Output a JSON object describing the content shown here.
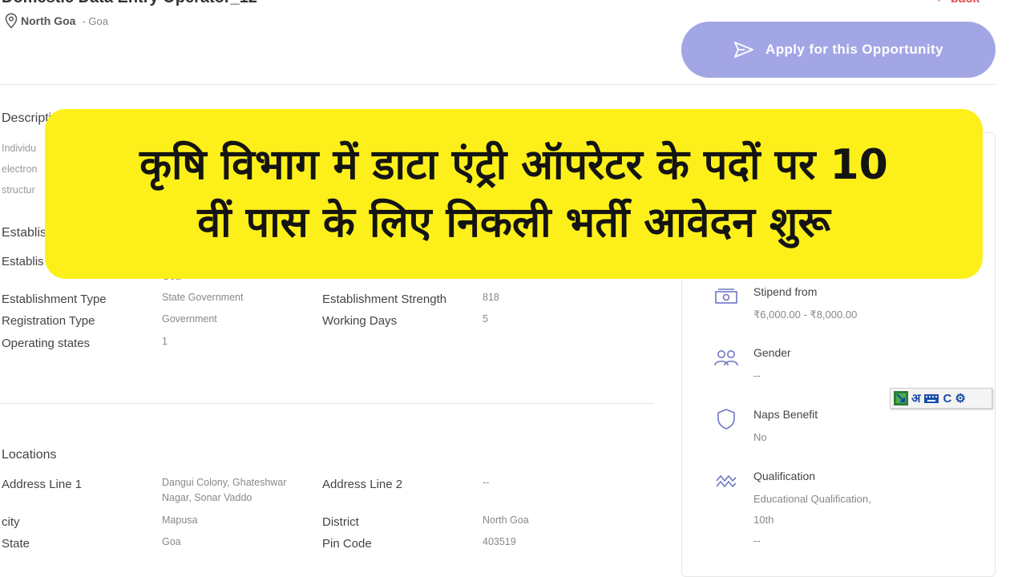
{
  "header": {
    "title_partial": "Domestic Data Entry Operator_12",
    "back_label": "back",
    "location_district": "North Goa",
    "location_state": "- Goa",
    "apply_label": "Apply for this Opportunity"
  },
  "description": {
    "title": "Descripti",
    "lines": [
      "Individu",
      "electron",
      "structur"
    ]
  },
  "establishment": {
    "title_partial": "Establis",
    "name_label_partial": "Establis",
    "name_value_partial": "Goa",
    "fields_left": [
      {
        "label": "Establishment Type",
        "value": "State Government"
      },
      {
        "label": "Registration Type",
        "value": "Government"
      },
      {
        "label": "Operating states",
        "value": "1"
      }
    ],
    "fields_right": [
      {
        "label": "Establishment Strength",
        "value": "818"
      },
      {
        "label": "Working Days",
        "value": "5"
      }
    ]
  },
  "locations": {
    "title": "Locations",
    "address_line1_label": "Address Line 1",
    "address_line1_value": "Dangui Colony, Ghateshwar Nagar, Sonar Vaddo",
    "address_line2_label": "Address Line 2",
    "address_line2_value": "--",
    "city_label": "city",
    "city_value": "Mapusa",
    "district_label": "District",
    "district_value": "North Goa",
    "state_label": "State",
    "state_value": "Goa",
    "pin_label": "Pin Code",
    "pin_value": "403519"
  },
  "sidebar": {
    "stipend_title": "Stipend from",
    "stipend_value": "₹6,000.00 - ₹8,000.00",
    "gender_title": "Gender",
    "gender_value": "--",
    "naps_title": "Naps Benefit",
    "naps_value": "No",
    "qualification_title": "Qualification",
    "qualification_value1": "Educational Qualification,",
    "qualification_value2": "10th",
    "qualification_value3": "--"
  },
  "banner": {
    "line1": "कृषि विभाग में डाटा एंट्री ऑपरेटर के पदों पर 10",
    "line2": "वीं पास के लिए निकली भर्ती आवेदन शुरू"
  },
  "ime_toolbar": {
    "hindi_glyph": "अ",
    "c_glyph": "C"
  },
  "colors": {
    "accent": "#a3a6e5",
    "icon": "#6e76c4",
    "banner_bg": "#fdf01a",
    "back": "#e05050"
  }
}
